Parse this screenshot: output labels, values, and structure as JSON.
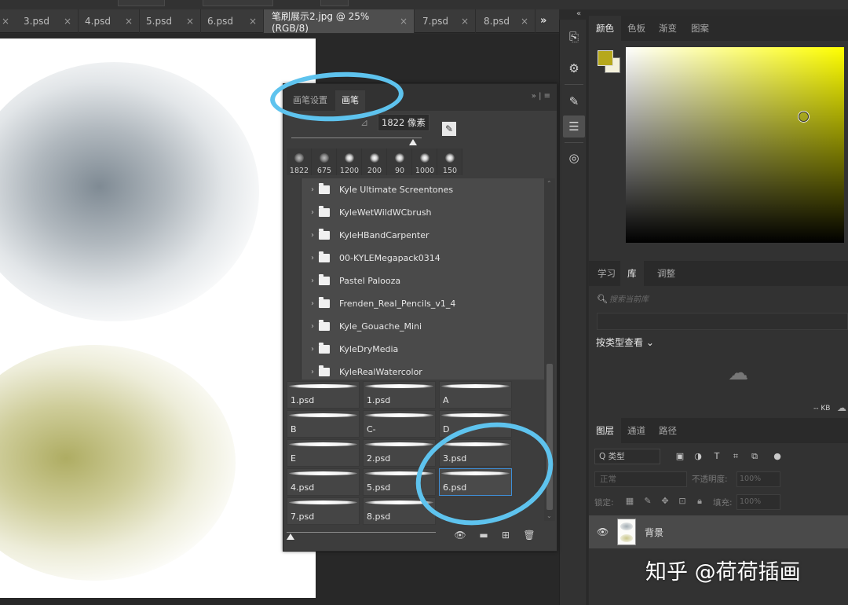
{
  "tabs": [
    {
      "label": "3.psd",
      "active": false
    },
    {
      "label": "4.psd",
      "active": false
    },
    {
      "label": "5.psd",
      "active": false
    },
    {
      "label": "6.psd",
      "active": false
    },
    {
      "label": "笔刷展示2.jpg @ 25%(RGB/8)",
      "active": true
    },
    {
      "label": "7.psd",
      "active": false
    },
    {
      "label": "8.psd",
      "active": false
    }
  ],
  "tab_close_glyph": "×",
  "tab_overflow_glyph": "»",
  "collapse_glyph": "«",
  "color_panel": {
    "tabs": [
      "颜色",
      "色板",
      "渐变",
      "图案"
    ],
    "active_tab": 0,
    "foreground_color": "#b6a81c",
    "background_color": "#f4f1dc",
    "hue": "#ffff00"
  },
  "library_panel": {
    "tabs": [
      "学习",
      "库",
      "调整"
    ],
    "active_tab": 1,
    "search_placeholder": "搜索当前库",
    "view_label": "按类型查看 ⌄",
    "kb_label": "-- KB"
  },
  "layers_panel": {
    "tabs": [
      "图层",
      "通道",
      "路径"
    ],
    "active_tab": 0,
    "filter_label": "Q 类型",
    "blend_mode": "正常",
    "opacity_label": "不透明度:",
    "opacity_value": "100%",
    "lock_label": "锁定:",
    "fill_label": "填充:",
    "fill_value": "100%",
    "layers": [
      {
        "name": "背景",
        "visible": true
      }
    ]
  },
  "brush_panel": {
    "tabs": [
      "画笔设置",
      "画笔"
    ],
    "active_tab": 1,
    "header_controls": "»  | ≡",
    "size_value": "1822 像素",
    "presets": [
      "1822",
      "675",
      "1200",
      "200",
      "90",
      "1000",
      "150"
    ],
    "folders": [
      "Kyle Ultimate Screentones",
      "KyleWetWildWCbrush",
      "KyleHBandCarpenter",
      "00-KYLEMegapack0314",
      "Pastel Palooza",
      "Frenden_Real_Pencils_v1_4",
      "Kyle_Gouache_Mini",
      "KyleDryMedia",
      "KyleRealWatercolor"
    ],
    "brushes": [
      {
        "name": "1.psd",
        "selected": false
      },
      {
        "name": "1.psd",
        "selected": false
      },
      {
        "name": "A",
        "selected": false
      },
      {
        "name": "B",
        "selected": false
      },
      {
        "name": "C-",
        "selected": false
      },
      {
        "name": "D",
        "selected": false
      },
      {
        "name": "E",
        "selected": false
      },
      {
        "name": "2.psd",
        "selected": false
      },
      {
        "name": "3.psd",
        "selected": false
      },
      {
        "name": "4.psd",
        "selected": false
      },
      {
        "name": "5.psd",
        "selected": false
      },
      {
        "name": "6.psd",
        "selected": true
      },
      {
        "name": "7.psd",
        "selected": false
      },
      {
        "name": "8.psd",
        "selected": false
      }
    ]
  },
  "annotation_color": "#5ec3ee",
  "watermark": "知乎 @荷荷插画"
}
